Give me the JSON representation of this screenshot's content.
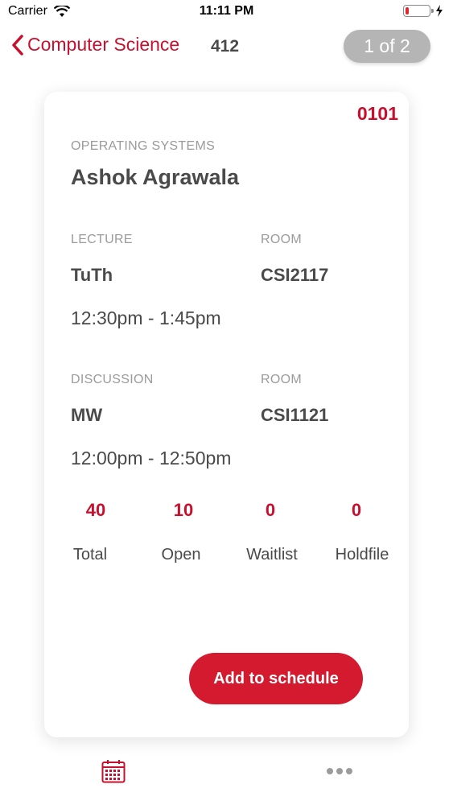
{
  "status_bar": {
    "carrier": "Carrier",
    "time": "11:11 PM",
    "battery_level": 0.15
  },
  "nav": {
    "back_label": "Computer Science",
    "course_number": "412",
    "page_indicator": "1 of 2"
  },
  "card": {
    "section_code": "0101",
    "course_title": "OPERATING SYSTEMS",
    "instructor": "Ashok Agrawala",
    "lecture": {
      "label": "LECTURE",
      "days": "TuTh",
      "time": "12:30pm - 1:45pm",
      "room_label": "ROOM",
      "room": "CSI2117"
    },
    "discussion": {
      "label": "DISCUSSION",
      "days": "MW",
      "time": "12:00pm - 12:50pm",
      "room_label": "ROOM",
      "room": "CSI1121"
    },
    "stats": [
      {
        "value": "40",
        "label": "Total"
      },
      {
        "value": "10",
        "label": "Open"
      },
      {
        "value": "0",
        "label": "Waitlist"
      },
      {
        "value": "0",
        "label": "Holdfile"
      }
    ],
    "add_button_label": "Add to schedule"
  },
  "tab_bar": {
    "icons": [
      "calendar-icon",
      "more-icon"
    ]
  },
  "colors": {
    "accent": "#c8102e",
    "pill": "#b5b5b5"
  }
}
